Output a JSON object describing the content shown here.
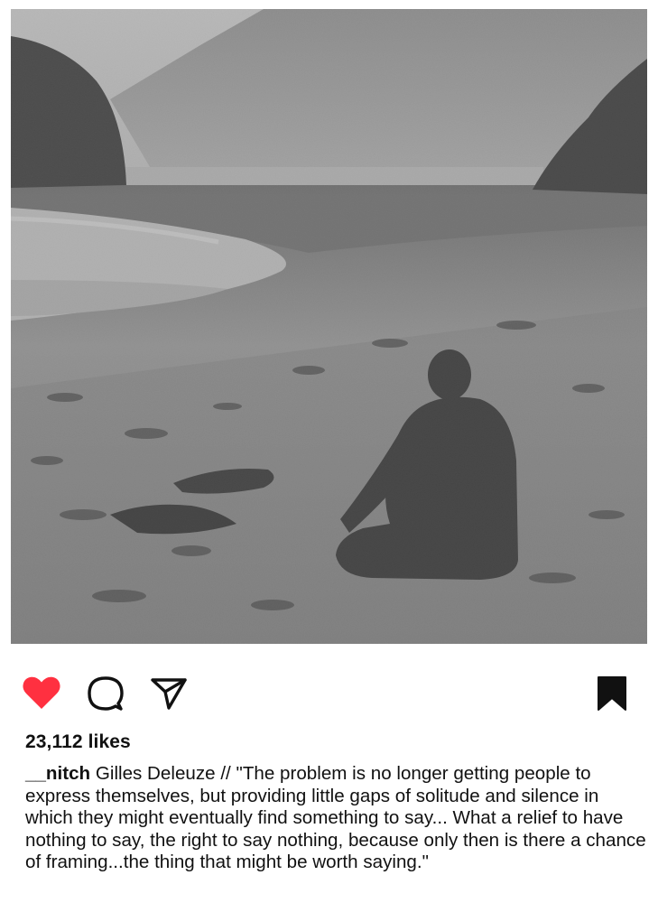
{
  "post": {
    "image_icon": "beach-photo",
    "likes": "23,112 likes",
    "username": "__nitch",
    "caption": "Gilles Deleuze // \"The problem is no longer getting people to express themselves, but providing little gaps of solitude and silence in which they might eventually find something to say... What a relief to have nothing to say, the right to say nothing, because only then is there a chance of framing...the thing that might be worth saying.\""
  },
  "actions": {
    "like_icon": "heart-icon",
    "comment_icon": "comment-icon",
    "share_icon": "send-icon",
    "save_icon": "bookmark-icon"
  },
  "colors": {
    "like": "#ff3040",
    "text": "#111111",
    "icon": "#111111"
  }
}
